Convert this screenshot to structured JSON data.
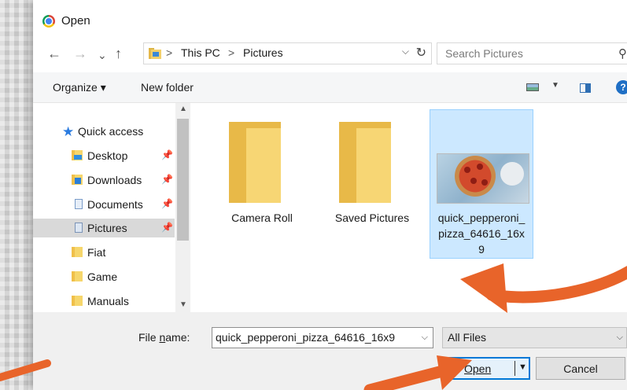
{
  "window": {
    "title": "Open",
    "icon": "chrome-icon"
  },
  "navigation": {
    "back_icon": "←",
    "forward_icon": "→",
    "recent_icon": "⌄",
    "up_icon": "↑",
    "breadcrumb": [
      "This PC",
      "Pictures"
    ],
    "separator": ">",
    "search_placeholder": "Search Pictures"
  },
  "toolbar": {
    "organize_label": "Organize ▾",
    "new_folder_label": "New folder"
  },
  "sidebar": {
    "items": [
      {
        "label": "Quick access",
        "icon": "star-icon"
      },
      {
        "label": "Desktop",
        "icon": "desktop-folder-icon",
        "pinned": true
      },
      {
        "label": "Downloads",
        "icon": "downloads-folder-icon",
        "pinned": true
      },
      {
        "label": "Documents",
        "icon": "documents-folder-icon",
        "pinned": true
      },
      {
        "label": "Pictures",
        "icon": "pictures-folder-icon",
        "pinned": true,
        "selected": true
      },
      {
        "label": "Fiat",
        "icon": "folder-icon"
      },
      {
        "label": "Game",
        "icon": "folder-icon"
      },
      {
        "label": "Manuals",
        "icon": "folder-icon"
      }
    ]
  },
  "files": [
    {
      "name": "Camera Roll",
      "type": "folder"
    },
    {
      "name": "Saved Pictures",
      "type": "folder"
    },
    {
      "name": "quick_pepperoni_pizza_64616_16x9",
      "display_lines": [
        "quick_pepperoni_",
        "pizza_64616_16x",
        "9"
      ],
      "type": "image",
      "selected": true
    }
  ],
  "footer": {
    "file_name_label_prefix": "File ",
    "file_name_label_access": "n",
    "file_name_label_suffix": "ame:",
    "file_name_value": "quick_pepperoni_pizza_64616_16x9",
    "file_type_value": "All Files",
    "open_label": "Open",
    "cancel_label": "Cancel"
  },
  "colors": {
    "accent": "#0078d7",
    "selection": "#cce8ff",
    "annotation_arrow": "#e8642a"
  }
}
